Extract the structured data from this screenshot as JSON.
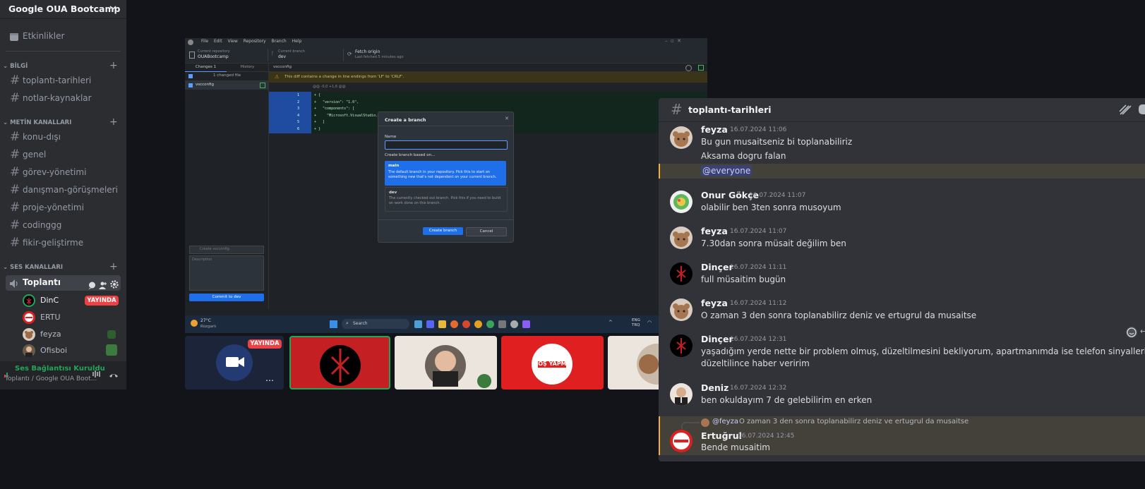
{
  "server": {
    "name": "Google OUA Bootcamp"
  },
  "events": {
    "label": "Etkinlikler"
  },
  "categories": {
    "bilgi": "BİLGİ",
    "metin": "METİN KANALLARI",
    "ses": "SES KANALLARI"
  },
  "bilgi_channels": [
    "toplantı-tarihleri",
    "notlar-kaynaklar"
  ],
  "text_channels": [
    "konu-dışı",
    "genel",
    "görev-yönetimi",
    "danışman-görüşmeleri",
    "proje-yönetimi",
    "codinggg",
    "fikir-geliştirme"
  ],
  "voice_channel": {
    "name": "Toplantı"
  },
  "voice_users": [
    {
      "name": "DinC",
      "badge": "YAYINDA"
    },
    {
      "name": "ERTU"
    },
    {
      "name": "feyza"
    },
    {
      "name": "Ofisboi"
    }
  ],
  "voice_status": {
    "title": "Ses Bağlantısı Kuruldu",
    "subtitle": "Toplantı / Google OUA Boot..."
  },
  "screen": {
    "menu": [
      "File",
      "Edit",
      "View",
      "Repository",
      "Branch",
      "Help"
    ],
    "repo_label": "Current repository",
    "repo_value": "OUABootcamp",
    "branch_label": "Current branch",
    "branch_value": "dev",
    "fetch_label": "Fetch origin",
    "fetch_sub": "Last fetched 5 minutes ago",
    "tab_changes": "Changes",
    "tab_changes_count": "1",
    "tab_history": "History",
    "changed_files": "1 changed file",
    "file": "vscconfig",
    "path": "vscconfig",
    "warning": "This diff contains a change in line endings from 'LF' to 'CRLF'.",
    "hunk": "@@ -0,0 +1,6 @@",
    "diff_lines": [
      {
        "n": "1",
        "t": "+ {"
      },
      {
        "n": "2",
        "t": "+   \"version\": \"1.0\","
      },
      {
        "n": "3",
        "t": "+   \"components\": ["
      },
      {
        "n": "4",
        "t": "+     \"Microsoft.VisualStudio.Wo"
      },
      {
        "n": "5",
        "t": "+   ]"
      },
      {
        "n": "6",
        "t": "+ }"
      }
    ],
    "summary_placeholder": "Create vscconfig",
    "description_placeholder": "Description",
    "commit": "Commit to dev",
    "dialog": {
      "title": "Create a branch",
      "name_label": "Name",
      "based_on": "Create branch based on...",
      "opt1_title": "main",
      "opt1_desc": "The default branch in your repository. Pick this to start on something new that's not dependent on your current branch.",
      "opt2_title": "dev",
      "opt2_desc": "The currently checked out branch. Pick this if you need to build on work done on this branch.",
      "create": "Create branch",
      "cancel": "Cancel"
    },
    "taskbar": {
      "temp": "27°C",
      "weather": "Rüzgarlı",
      "search": "Search",
      "lang1": "ENG",
      "lang2": "TRQ"
    }
  },
  "tiles": {
    "live_badge": "YAYINDA",
    "bos_yapma": "BOŞ YAPMA"
  },
  "chat": {
    "channel": "toplantı-tarihleri",
    "messages": [
      {
        "author": "feyza",
        "time": "16.07.2024 11:06",
        "lines": [
          "Bu gun musaitseniz bi toplanabiliriz",
          "Aksama dogru falan"
        ],
        "mention": "@everyone"
      },
      {
        "author": "Onur Gökçe",
        "time": "16.07.2024 11:07",
        "lines": [
          "olabilir ben 3ten sonra musoyum"
        ]
      },
      {
        "author": "feyza",
        "time": "16.07.2024 11:07",
        "lines": [
          "7.30dan sonra müsait değilim ben"
        ]
      },
      {
        "author": "Dinçer",
        "time": "16.07.2024 11:11",
        "lines": [
          "full müsaitim bugün"
        ]
      },
      {
        "author": "feyza",
        "time": "16.07.2024 11:12",
        "lines": [
          "O zaman 3 den sonra toplanabilirz deniz ve ertugrul da musaitse"
        ]
      },
      {
        "author": "Dinçer",
        "time": "16.07.2024 12:31",
        "lines": [
          "yaşadığım yerde nette bir problem olmuş, düzeltilmesini bekliyorum, apartmanımda ise telefon sinyalleri çok iyi değil,",
          "düzeltilince haber veririm"
        ]
      },
      {
        "author": "Deniz",
        "time": "16.07.2024 12:32",
        "lines": [
          "ben okuldayım 7 de gelebilirim en erken"
        ]
      },
      {
        "author": "Ertuğrul",
        "time": "16.07.2024 12:45",
        "lines": [
          "Bende musaitim"
        ],
        "reply_to": "@feyza",
        "reply_text": "O zaman 3 den sonra toplanabilirz deniz ve ertugrul da musaitse"
      }
    ]
  },
  "colors": {
    "sidebar": "#2b2d31",
    "chat": "#313338",
    "live": "#ed4245",
    "green": "#23a559",
    "accent": "#5865f2"
  }
}
